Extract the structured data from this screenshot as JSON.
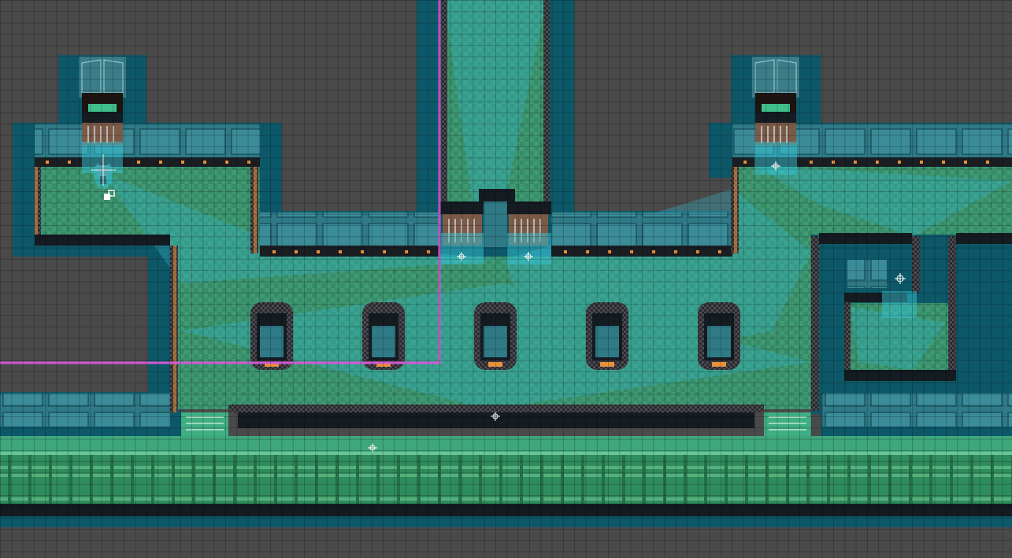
{
  "scene": {
    "view": "tile-map-editor",
    "grid": true,
    "colors": {
      "background": "#4a4a4a",
      "floor": "#3f9a73",
      "floor_dark": "#2f7d60",
      "walkable_overlay": "#35b5c9",
      "wall_top": "#0d5868",
      "wall_face": "#2f7a86",
      "ledge": "#141b21",
      "trim_brick": "#5a3f2e",
      "trim_amber": "#e8903a",
      "path_line": "#d35ad6"
    },
    "icons": [
      "player-character-icon",
      "cursor-marker-icon",
      "door-icon",
      "gate-icon",
      "waypoint-icon",
      "pillar-icon",
      "stairs-icon",
      "rail-track-icon"
    ]
  }
}
